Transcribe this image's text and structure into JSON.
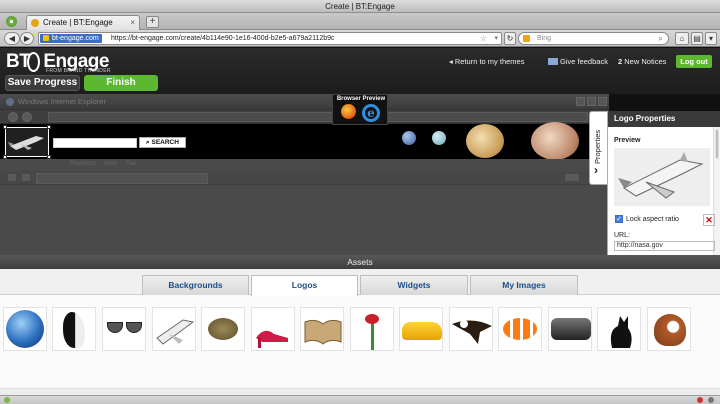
{
  "window": {
    "title": "Create | BT:Engage"
  },
  "tab": {
    "label": "Create | BT:Engage",
    "close": "×",
    "new_tab": "+"
  },
  "nav": {
    "site_badge": "bt-engage.com",
    "url": "https://bt-engage.com/create/4b114e90-1e16-400d-b2e5-a679a2112b9c",
    "search_placeholder": "Bing"
  },
  "app": {
    "logo_text": "BT",
    "logo_text2": "Engage",
    "logo_subtitle": "FROM BRAND THUNDER",
    "save_label": "Save Progress",
    "finish_label": "Finish",
    "return_link": "Return to my themes",
    "feedback_link": "Give feedback",
    "notices_count": "2",
    "notices_label": "New Notices",
    "logout_label": "Log out"
  },
  "preview": {
    "label": "Browser Preview",
    "window_title": "Windows Internet Explorer",
    "search_button": "SEARCH",
    "links": [
      "Products",
      "Web",
      "Tab"
    ]
  },
  "properties": {
    "tab_label": "Properties",
    "title": "Logo Properties",
    "preview_label": "Preview",
    "lock_label": "Lock aspect ratio",
    "url_label": "URL:",
    "url_value": "http://nasa.gov"
  },
  "assets": {
    "title": "Assets",
    "tabs": [
      "Backgrounds",
      "Logos",
      "Widgets",
      "My Images"
    ],
    "active_tab": "Logos",
    "items": [
      "earth",
      "orca",
      "sunglasses",
      "space-shuttle",
      "turtle",
      "red-high-heel",
      "open-book",
      "flower",
      "sports-car",
      "eagle",
      "clownfish",
      "vintage-car",
      "black-cat",
      "baseball-glove"
    ]
  },
  "colors": {
    "accent": "#5cb82e",
    "header": "#222222",
    "link": "#1a4f8a"
  }
}
